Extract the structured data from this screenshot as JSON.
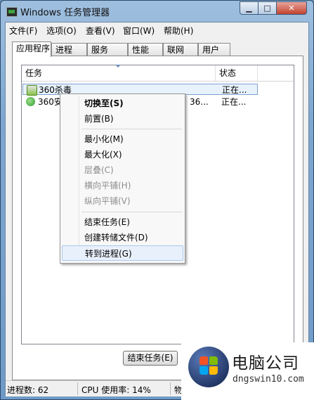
{
  "window": {
    "title": "Windows 任务管理器",
    "minimize_glyph": "▁",
    "maximize_glyph": "□",
    "close_glyph": "✕"
  },
  "menubar": [
    "文件(F)",
    "选项(O)",
    "查看(V)",
    "窗口(W)",
    "帮助(H)"
  ],
  "tabs": [
    "应用程序",
    "进程",
    "服务",
    "性能",
    "联网",
    "用户"
  ],
  "active_tab": "应用程序",
  "list": {
    "columns": [
      "任务",
      "状态"
    ],
    "rows": [
      {
        "name": "360杀毒",
        "extra": "",
        "status": "正在...",
        "icon": "360-shield-icon",
        "selected": true
      },
      {
        "name": "360安",
        "extra": "36...",
        "status": "正在...",
        "icon": "360-safe-icon",
        "selected": false
      }
    ]
  },
  "end_task_button": "结束任务(E)",
  "statusbar": {
    "processes": "进程数: 62",
    "cpu": "CPU 使用率: 14%",
    "memory": "物"
  },
  "context_menu": {
    "items": [
      {
        "label": "切换至(S)",
        "bold": true
      },
      {
        "label": "前置(B)"
      },
      {
        "label": "最小化(M)"
      },
      {
        "label": "最大化(X)"
      },
      {
        "label": "层叠(C)",
        "disabled": true
      },
      {
        "label": "横向平铺(H)",
        "disabled": true
      },
      {
        "label": "纵向平铺(V)",
        "disabled": true
      },
      {
        "label": "结束任务(E)"
      },
      {
        "label": "创建转储文件(D)"
      },
      {
        "label": "转到进程(G)",
        "hover": true
      }
    ]
  },
  "watermark": {
    "title": "电脑公司",
    "url": "dngswin10.com"
  },
  "colors": {
    "title_gradient": "#7ea7cf",
    "selection": "#e8f2fc",
    "hover": "#e8f0fb"
  }
}
